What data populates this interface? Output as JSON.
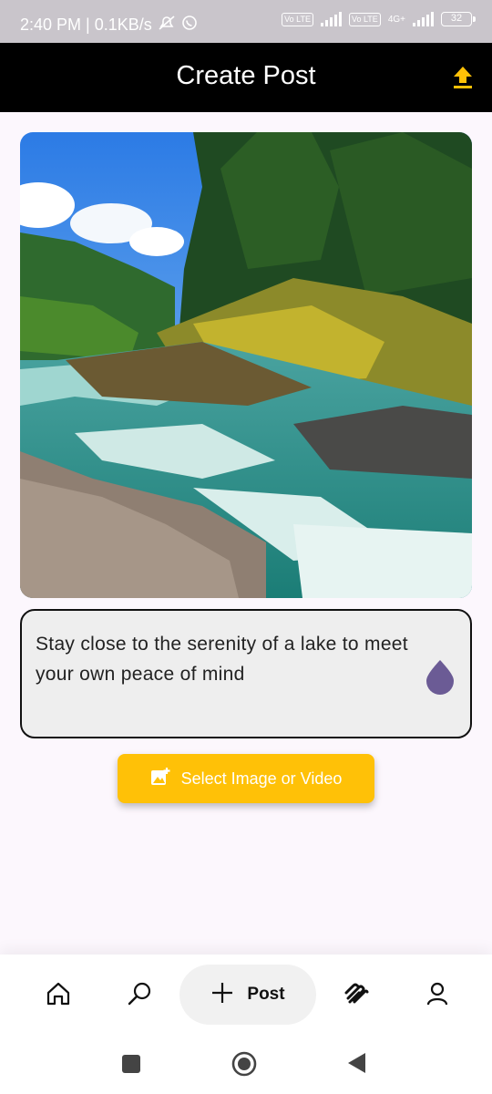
{
  "status_bar": {
    "time_speed": "2:40 PM | 0.1KB/s",
    "network_label": "4G+",
    "volte_label_1": "Vo LTE",
    "volte_label_2": "Vo LTE",
    "battery": "32"
  },
  "header": {
    "title": "Create Post",
    "upload_icon": "upload-icon"
  },
  "post": {
    "image_alt": "river-landscape-photo",
    "caption": "Stay close to the serenity of a lake to meet your own peace of mind"
  },
  "select_button": {
    "label": "Select Image or Video",
    "icon": "add-photo-icon"
  },
  "bottom_nav": {
    "items": [
      {
        "icon": "home-icon"
      },
      {
        "icon": "search-icon"
      },
      {
        "icon": "plus-icon",
        "label": "Post"
      },
      {
        "icon": "squarespace-icon"
      },
      {
        "icon": "profile-icon"
      }
    ]
  },
  "colors": {
    "accent": "#ffc107",
    "app_bar": "#000000",
    "drop": "#6b5b95",
    "background": "#fcf7fd"
  }
}
